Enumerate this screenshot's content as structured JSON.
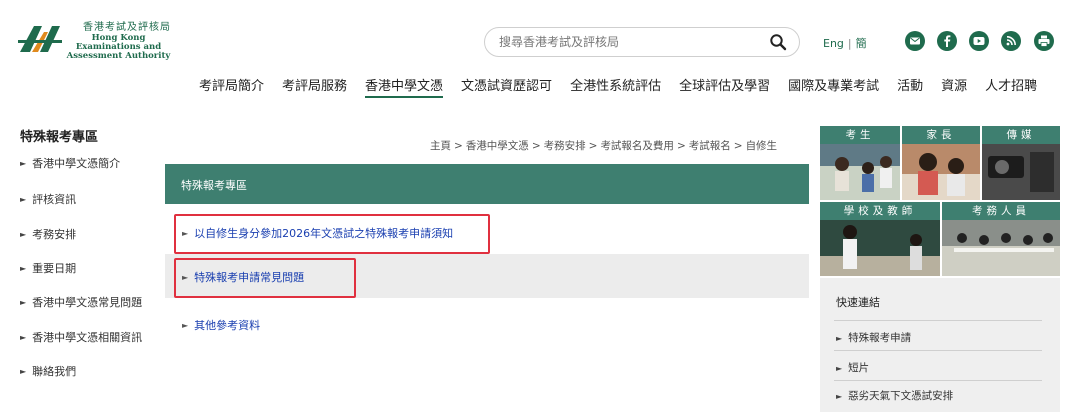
{
  "logo": {
    "zh": "香港考試及評核局",
    "en_line1": "Hong Kong",
    "en_line2": "Examinations and",
    "en_line3": "Assessment Authority"
  },
  "search": {
    "placeholder": "搜尋香港考試及評核局"
  },
  "lang": {
    "eng": "Eng",
    "sep": "|",
    "simplified": "簡"
  },
  "social_icons": [
    "email-icon",
    "facebook-icon",
    "youtube-icon",
    "rss-icon",
    "print-icon"
  ],
  "mainnav": [
    "考評局簡介",
    "考評局服務",
    "香港中學文憑",
    "文憑試資歷認可",
    "全港性系統評估",
    "全球評估及學習",
    "國際及專業考試",
    "活動",
    "資源",
    "人才招聘"
  ],
  "sidebar": {
    "title": "特殊報考專區",
    "items": [
      "香港中學文憑簡介",
      "評核資訊",
      "考務安排",
      "重要日期",
      "香港中學文憑常見問題",
      "香港中學文憑相關資訊",
      "聯絡我們"
    ]
  },
  "breadcrumb": [
    "主頁",
    "香港中學文憑",
    "考務安排",
    "考試報名及費用",
    "考試報名",
    "自修生"
  ],
  "breadcrumb_sep": ">",
  "section_title": "特殊報考專區",
  "links": [
    "以自修生身分參加2026年文憑試之特殊報考申請須知",
    "特殊報考申請常見問題",
    "其他參考資料"
  ],
  "tiles": [
    "考生",
    "家長",
    "傳媒",
    "學校及教師",
    "考務人員"
  ],
  "quick_links": {
    "title": "快速連結",
    "items": [
      "特殊報考申請",
      "短片",
      "惡劣天氣下文憑試安排"
    ]
  },
  "colors": {
    "brand_green": "#1f6b4d",
    "teal_bar": "#3e7f70",
    "link_blue": "#1a3fb0",
    "highlight_red": "#e0303f"
  }
}
